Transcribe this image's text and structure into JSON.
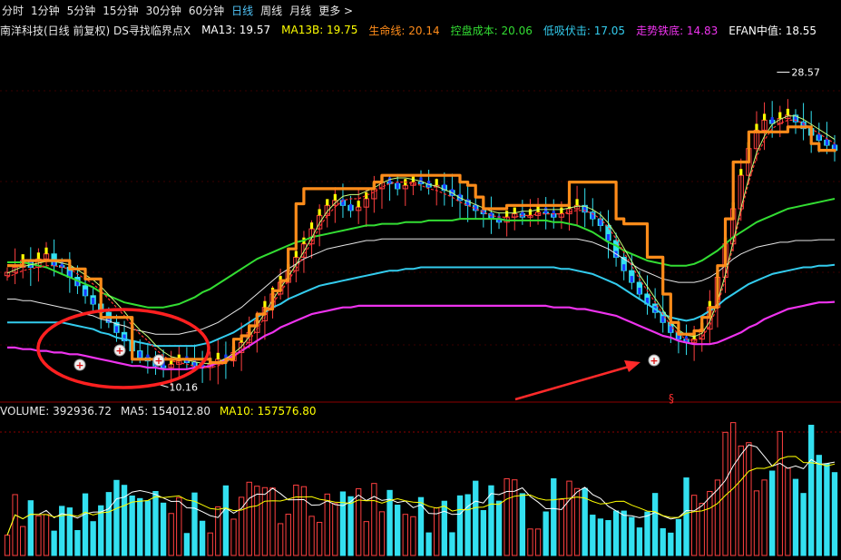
{
  "tabs": [
    {
      "label": "分时",
      "active": false
    },
    {
      "label": "1分钟",
      "active": false
    },
    {
      "label": "5分钟",
      "active": false
    },
    {
      "label": "15分钟",
      "active": false
    },
    {
      "label": "30分钟",
      "active": false
    },
    {
      "label": "60分钟",
      "active": false
    },
    {
      "label": "日线",
      "active": true
    },
    {
      "label": "周线",
      "active": false
    },
    {
      "label": "月线",
      "active": false
    },
    {
      "label": "更多 >",
      "active": false
    }
  ],
  "title": {
    "stock": "南洋科技(日线 前复权) DS寻找临界点X",
    "ma13": "MA13: 19.57",
    "ma13b": "MA13B: 19.75",
    "life_line": "生命线: 20.14",
    "control_cost": "控盘成本: 20.06",
    "low_absorb": "低吸伏击: 17.05",
    "trend_bottom": "走势铁底: 14.83",
    "efan": "EFAN中值: 18.55"
  },
  "colors": {
    "up": "#ff4040",
    "down": "#33e0f0",
    "ma13": "#ffffff",
    "ma13b": "#ffff00",
    "life_line": "#ff8c1a",
    "control_cost": "#33dd33",
    "low_absorb": "#33ccee",
    "trend_bottom": "#ee33ee",
    "efan": "#ffffff"
  },
  "annotations": {
    "high_label": "28.57",
    "low_label": "10.16",
    "signal_glyph": "§",
    "buy_marker": "+"
  },
  "volume": {
    "volume": "VOLUME: 392936.72",
    "ma5": "MA5: 154012.80",
    "ma10": "MA10: 157576.80"
  },
  "chart_data": {
    "type": "candlestick",
    "price_range": [
      9.0,
      30.5
    ],
    "close": [
      16.6,
      16.9,
      17.3,
      16.9,
      17.4,
      17.7,
      17.0,
      16.9,
      16.3,
      15.8,
      15.2,
      14.7,
      14.2,
      13.6,
      13.0,
      12.5,
      11.9,
      11.5,
      11.3,
      11.0,
      10.9,
      11.1,
      11.3,
      11.2,
      11.0,
      10.9,
      11.1,
      11.4,
      11.3,
      11.8,
      12.4,
      13.0,
      13.7,
      14.5,
      15.3,
      16.0,
      16.7,
      17.5,
      18.3,
      19.2,
      20.0,
      20.6,
      20.9,
      20.6,
      20.3,
      20.5,
      21.0,
      21.6,
      22.0,
      21.9,
      21.6,
      21.8,
      22.0,
      21.9,
      21.7,
      21.8,
      21.5,
      21.2,
      20.9,
      20.6,
      20.3,
      20.1,
      19.8,
      19.6,
      19.9,
      20.1,
      19.9,
      20.0,
      20.2,
      20.1,
      19.9,
      20.1,
      20.4,
      20.6,
      20.2,
      19.8,
      19.4,
      18.5,
      17.5,
      16.7,
      16.0,
      15.3,
      14.7,
      14.2,
      13.6,
      13.0,
      12.6,
      12.4,
      12.6,
      13.2,
      14.5,
      16.3,
      18.3,
      20.4,
      22.4,
      24.0,
      25.1,
      25.7,
      25.5,
      25.8,
      26.0,
      25.6,
      25.2,
      24.8,
      24.5,
      24.2,
      23.9
    ],
    "life_line": [
      17.0,
      17.0,
      17.3,
      17.3,
      17.3,
      17.3,
      17.3,
      17.3,
      16.8,
      16.8,
      16.2,
      16.2,
      13.9,
      13.9,
      13.9,
      13.9,
      11.4,
      11.4,
      11.4,
      11.4,
      11.4,
      11.4,
      11.4,
      11.4,
      11.4,
      11.4,
      11.2,
      11.2,
      11.4,
      12.6,
      12.8,
      13.4,
      14.1,
      14.4,
      15.5,
      16.1,
      18.0,
      20.7,
      21.6,
      21.6,
      21.6,
      21.6,
      21.6,
      21.6,
      21.6,
      21.6,
      21.6,
      22.0,
      22.4,
      22.4,
      22.4,
      22.4,
      22.4,
      22.4,
      22.4,
      22.4,
      22.4,
      22.4,
      22.0,
      21.8,
      21.1,
      20.4,
      20.4,
      20.4,
      20.6,
      20.6,
      20.6,
      20.6,
      20.6,
      20.6,
      20.6,
      20.6,
      22.0,
      22.0,
      22.0,
      22.0,
      22.0,
      22.0,
      19.8,
      19.5,
      19.5,
      19.5,
      17.5,
      17.5,
      15.3,
      13.6,
      12.9,
      12.9,
      13.1,
      13.9,
      14.5,
      17.0,
      19.8,
      23.2,
      23.2,
      25.0,
      25.0,
      25.0,
      25.0,
      25.0,
      25.3,
      25.3,
      25.3,
      24.3,
      23.9,
      23.9,
      23.8
    ],
    "control_cost": [
      16.3,
      16.5,
      16.7,
      16.8,
      16.9,
      17.0,
      17.0,
      16.9,
      16.8,
      16.5,
      16.2,
      15.9,
      15.5,
      15.0,
      14.5,
      14.0,
      13.4,
      12.9,
      12.5,
      12.0,
      11.6,
      11.3,
      11.2,
      11.1,
      11.0,
      10.9,
      10.9,
      11.0,
      11.2,
      11.5,
      11.9,
      12.5,
      13.2,
      13.9,
      14.7,
      15.4,
      16.1,
      16.8,
      17.6,
      18.4,
      19.3,
      20.0,
      20.5,
      20.9,
      21.0,
      21.0,
      21.2,
      21.4,
      21.7,
      21.9,
      22.0,
      22.0,
      21.9,
      21.8,
      21.6,
      21.5,
      21.3,
      21.1,
      20.8,
      20.6,
      20.4,
      20.2,
      20.0,
      19.9,
      19.9,
      19.9,
      20.0,
      20.0,
      20.1,
      20.1,
      20.1,
      20.1,
      20.2,
      20.3,
      20.3,
      20.1,
      19.8,
      19.3,
      18.6,
      17.8,
      17.0,
      16.2,
      15.5,
      14.8,
      14.1,
      13.4,
      12.9,
      12.6,
      12.5,
      12.7,
      13.4,
      14.6,
      16.2,
      18.2,
      20.2,
      22.0,
      23.5,
      24.5,
      25.2,
      25.5,
      25.7,
      25.7,
      25.5,
      25.2,
      24.9,
      24.6,
      24.3
    ],
    "low_absorb": [
      13.6,
      13.6,
      13.6,
      13.6,
      13.6,
      13.6,
      13.6,
      13.6,
      13.5,
      13.4,
      13.3,
      13.2,
      13.0,
      12.9,
      12.7,
      12.6,
      12.5,
      12.4,
      12.3,
      12.2,
      12.2,
      12.2,
      12.2,
      12.2,
      12.2,
      12.3,
      12.4,
      12.6,
      12.8,
      13.0,
      13.3,
      13.6,
      13.9,
      14.2,
      14.5,
      14.7,
      15.0,
      15.2,
      15.4,
      15.6,
      15.8,
      15.9,
      16.0,
      16.1,
      16.2,
      16.3,
      16.4,
      16.5,
      16.6,
      16.7,
      16.7,
      16.8,
      16.8,
      16.9,
      16.9,
      16.9,
      16.9,
      16.9,
      16.9,
      16.9,
      16.9,
      16.9,
      16.9,
      16.9,
      16.9,
      16.9,
      16.9,
      16.9,
      16.9,
      16.9,
      16.9,
      16.8,
      16.8,
      16.7,
      16.6,
      16.5,
      16.3,
      16.1,
      15.9,
      15.6,
      15.3,
      15.0,
      14.7,
      14.4,
      14.1,
      13.9,
      13.8,
      13.7,
      13.8,
      14.0,
      14.3,
      14.6,
      15.0,
      15.3,
      15.6,
      15.9,
      16.1,
      16.3,
      16.5,
      16.6,
      16.7,
      16.8,
      16.9,
      16.9,
      17.0,
      17.0,
      17.05
    ],
    "efan": [
      15.0,
      15.0,
      14.9,
      14.9,
      14.8,
      14.7,
      14.6,
      14.5,
      14.4,
      14.3,
      14.1,
      14.0,
      13.8,
      13.7,
      13.5,
      13.4,
      13.2,
      13.1,
      13.0,
      12.9,
      12.9,
      12.9,
      12.9,
      13.0,
      13.1,
      13.2,
      13.4,
      13.6,
      13.9,
      14.2,
      14.5,
      14.9,
      15.3,
      15.7,
      16.1,
      16.5,
      16.8,
      17.1,
      17.4,
      17.6,
      17.8,
      18.0,
      18.1,
      18.2,
      18.3,
      18.4,
      18.5,
      18.5,
      18.6,
      18.6,
      18.6,
      18.6,
      18.6,
      18.6,
      18.6,
      18.6,
      18.6,
      18.6,
      18.6,
      18.6,
      18.6,
      18.6,
      18.6,
      18.6,
      18.6,
      18.6,
      18.6,
      18.6,
      18.6,
      18.6,
      18.6,
      18.6,
      18.6,
      18.6,
      18.5,
      18.4,
      18.2,
      18.0,
      17.7,
      17.4,
      17.1,
      16.8,
      16.6,
      16.4,
      16.2,
      16.1,
      16.0,
      16.0,
      16.0,
      16.1,
      16.3,
      16.6,
      17.0,
      17.4,
      17.7,
      17.9,
      18.1,
      18.2,
      18.3,
      18.4,
      18.4,
      18.5,
      18.5,
      18.5,
      18.55,
      18.55,
      18.55
    ],
    "green_line": [
      17.2,
      17.2,
      17.2,
      17.1,
      17.0,
      16.9,
      16.7,
      16.5,
      16.3,
      16.1,
      15.9,
      15.7,
      15.4,
      15.2,
      15.0,
      14.8,
      14.7,
      14.6,
      14.5,
      14.5,
      14.5,
      14.6,
      14.7,
      14.9,
      15.1,
      15.4,
      15.6,
      15.9,
      16.2,
      16.5,
      16.8,
      17.1,
      17.4,
      17.6,
      17.8,
      18.0,
      18.2,
      18.4,
      18.5,
      18.7,
      18.8,
      18.9,
      19.0,
      19.1,
      19.2,
      19.3,
      19.4,
      19.4,
      19.5,
      19.5,
      19.5,
      19.6,
      19.6,
      19.6,
      19.7,
      19.7,
      19.7,
      19.7,
      19.8,
      19.8,
      19.8,
      19.8,
      19.8,
      19.8,
      19.7,
      19.7,
      19.7,
      19.7,
      19.7,
      19.7,
      19.6,
      19.6,
      19.5,
      19.4,
      19.2,
      19.0,
      18.7,
      18.4,
      18.2,
      17.9,
      17.7,
      17.5,
      17.3,
      17.2,
      17.1,
      17.0,
      17.0,
      17.0,
      17.1,
      17.3,
      17.6,
      17.9,
      18.3,
      18.7,
      19.0,
      19.3,
      19.6,
      19.8,
      20.0,
      20.2,
      20.4,
      20.5,
      20.6,
      20.7,
      20.8,
      20.9,
      21.0
    ],
    "trend_bottom": [
      12.1,
      12.1,
      12.0,
      12.0,
      11.9,
      11.9,
      11.8,
      11.8,
      11.7,
      11.7,
      11.6,
      11.5,
      11.4,
      11.3,
      11.2,
      11.1,
      11.0,
      11.0,
      10.9,
      10.9,
      10.8,
      10.8,
      10.8,
      10.8,
      10.9,
      10.9,
      11.0,
      11.2,
      11.4,
      11.6,
      11.9,
      12.2,
      12.5,
      12.8,
      13.0,
      13.3,
      13.5,
      13.7,
      13.9,
      14.1,
      14.2,
      14.3,
      14.4,
      14.5,
      14.5,
      14.6,
      14.6,
      14.6,
      14.6,
      14.6,
      14.6,
      14.6,
      14.6,
      14.6,
      14.6,
      14.6,
      14.6,
      14.6,
      14.6,
      14.6,
      14.6,
      14.6,
      14.6,
      14.6,
      14.6,
      14.6,
      14.6,
      14.6,
      14.6,
      14.6,
      14.5,
      14.5,
      14.5,
      14.4,
      14.4,
      14.3,
      14.2,
      14.1,
      14.0,
      13.8,
      13.6,
      13.4,
      13.2,
      13.0,
      12.8,
      12.7,
      12.5,
      12.4,
      12.3,
      12.3,
      12.3,
      12.4,
      12.6,
      12.8,
      13.0,
      13.3,
      13.5,
      13.8,
      14.0,
      14.2,
      14.4,
      14.5,
      14.6,
      14.7,
      14.8,
      14.8,
      14.83
    ],
    "volume_range": [
      0,
      400000
    ],
    "volume_ma5_scale": "MA5",
    "volume_ma10_scale": "MA10"
  }
}
